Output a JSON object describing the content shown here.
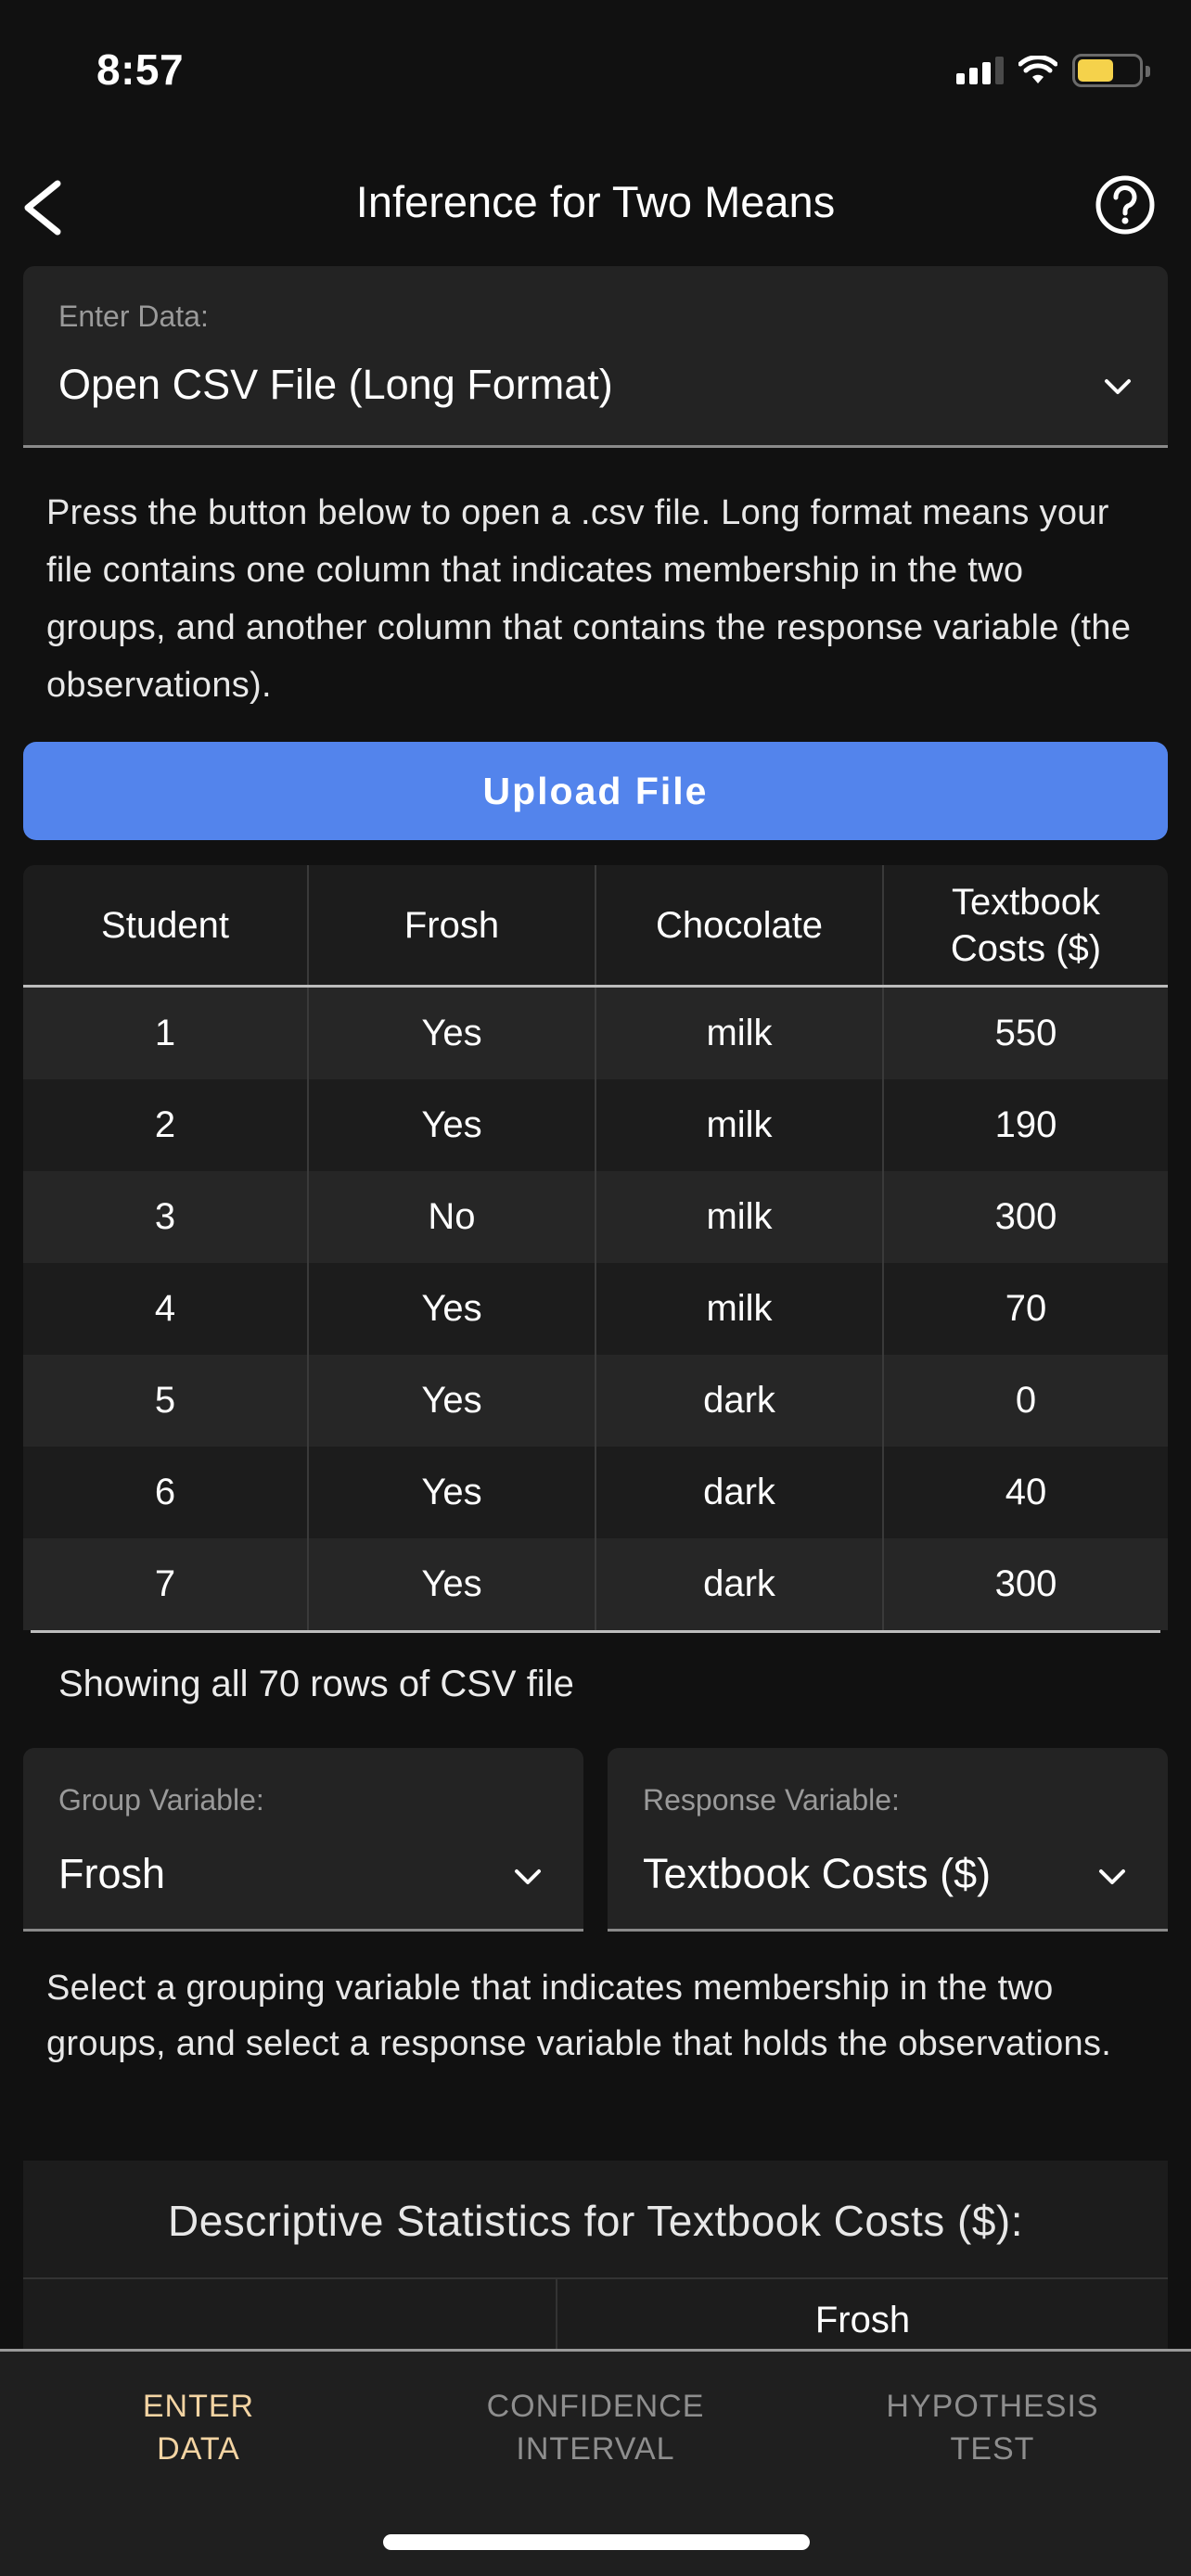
{
  "status_bar": {
    "time": "8:57",
    "icons": [
      "cellular-signal-icon",
      "wifi-icon",
      "battery-icon"
    ],
    "battery_level_fraction": 0.6,
    "battery_color": "#f5d24b"
  },
  "nav": {
    "title": "Inference for Two Means",
    "back_icon": "chevron-left-icon",
    "help_icon": "question-circle-icon"
  },
  "enter_data": {
    "label": "Enter Data:",
    "value": "Open CSV File (Long Format)"
  },
  "intro_text": "Press the button below to open a .csv file. Long format means your file contains one column that indicates membership in the two groups, and another column that contains the response variable (the observations).",
  "upload_button": {
    "label": "Upload File",
    "color": "#5384ec"
  },
  "table": {
    "headers": [
      "Student",
      "Frosh",
      "Chocolate",
      "Textbook Costs ($)"
    ],
    "rows": [
      [
        "1",
        "Yes",
        "milk",
        "550"
      ],
      [
        "2",
        "Yes",
        "milk",
        "190"
      ],
      [
        "3",
        "No",
        "milk",
        "300"
      ],
      [
        "4",
        "Yes",
        "milk",
        "70"
      ],
      [
        "5",
        "Yes",
        "dark",
        "0"
      ],
      [
        "6",
        "Yes",
        "dark",
        "40"
      ],
      [
        "7",
        "Yes",
        "dark",
        "300"
      ]
    ]
  },
  "rows_note": "Showing all 70 rows of CSV file",
  "group_variable": {
    "label": "Group Variable:",
    "value": "Frosh"
  },
  "response_variable": {
    "label": "Response Variable:",
    "value": "Textbook Costs ($)"
  },
  "select_help_text": "Select a grouping variable that indicates membership in the two groups, and select a response variable that holds the observations.",
  "descriptive_stats": {
    "title": "Descriptive Statistics for Textbook Costs ($):",
    "columns": [
      "",
      "Frosh"
    ]
  },
  "tabs": [
    {
      "label_line1": "ENTER",
      "label_line2": "DATA",
      "active": true
    },
    {
      "label_line1": "CONFIDENCE",
      "label_line2": "INTERVAL",
      "active": false
    },
    {
      "label_line1": "HYPOTHESIS",
      "label_line2": "TEST",
      "active": false
    }
  ],
  "colors": {
    "background": "#111111",
    "card": "#232323",
    "active_tab": "#f3d4a3",
    "inactive_tab": "#8e8e8e"
  }
}
